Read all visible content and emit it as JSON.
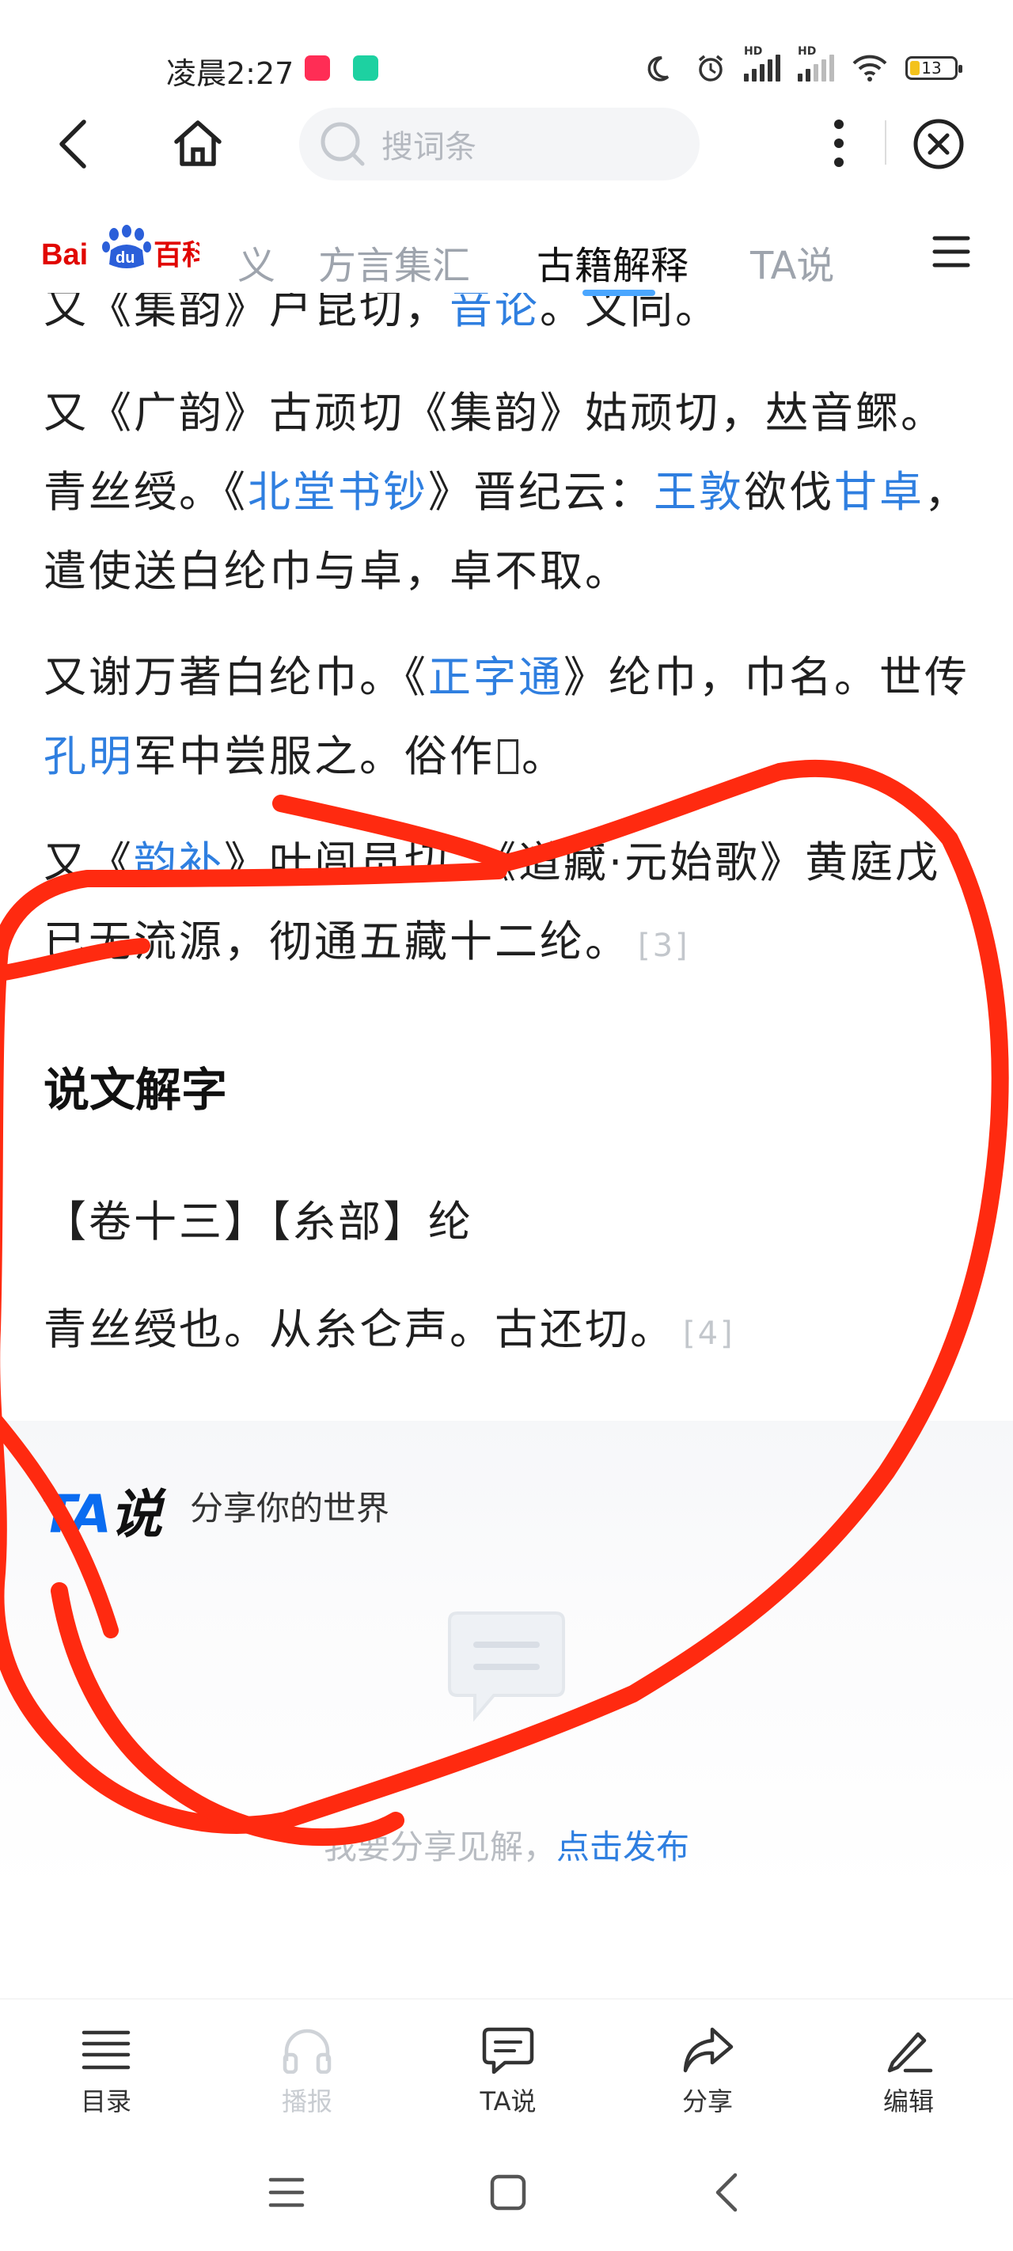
{
  "status_bar": {
    "time": "凌晨2:27",
    "badge1_color": "#ff2d55",
    "badge2_color": "#1dd1a1",
    "battery_level": "13",
    "network_labels": [
      "HD",
      "HD"
    ]
  },
  "nav": {
    "back_icon": "back-arrow-icon",
    "home_icon": "home-icon",
    "search_placeholder": "搜词条",
    "more_icon": "more-vertical-icon",
    "close_icon": "close-circle-icon"
  },
  "tabs": {
    "logo_text": "Bai du 百科",
    "items": [
      "义",
      "方言集汇",
      "古籍解释",
      "TA说"
    ],
    "active": "古籍解释",
    "menu_icon": "menu-icon"
  },
  "article": {
    "p0": {
      "a": "又《集韵》户昆切，",
      "link": "音论",
      "b": "。义同。"
    },
    "p1": {
      "a": "又《广韵》古顽切《集韵》姑顽切，𠀤音鳏。青丝绶。《",
      "link1": "北堂书钞",
      "b": "》晋纪云：",
      "link2": "王敦",
      "c": "欲伐",
      "link3": "甘卓",
      "d": "，遣使送白纶巾与卓，卓不取。"
    },
    "p2": {
      "a": "又谢万著白纶巾。《",
      "link1": "正字通",
      "b": "》纶巾，巾名。世传",
      "link2": "孔明",
      "c": "军中尝服之。俗作",
      "d": "。"
    },
    "p3": {
      "a": "又《",
      "link1": "韵补",
      "b": "》叶闾员切。《道藏·元始歌》黄庭戊已无流源，彻通五藏十二纶。",
      "cite": "[3]"
    },
    "shuowen_heading": "说文解字",
    "shuowen_volume": "【卷十三】【糸部】纶",
    "shuowen_text": "青丝绶也。从糸仑声。古还切。",
    "shuowen_cite": "[4]"
  },
  "ta_section": {
    "logo_ta": "TA",
    "logo_shuo": "说",
    "slogan": "分享你的世界",
    "publish_prefix": "我要分享见解，",
    "publish_link": "点击发布"
  },
  "toolbar": [
    {
      "label": "目录",
      "icon": "list-icon",
      "enabled": true
    },
    {
      "label": "播报",
      "icon": "headphones-icon",
      "enabled": false
    },
    {
      "label": "TA说",
      "icon": "comment-icon",
      "enabled": true
    },
    {
      "label": "分享",
      "icon": "share-icon",
      "enabled": true
    },
    {
      "label": "编辑",
      "icon": "edit-pen-icon",
      "enabled": true
    }
  ],
  "system_nav": [
    "menu-lines-icon",
    "square-home-icon",
    "back-chevron-icon"
  ],
  "colors": {
    "link": "#2f7fe0",
    "annotation_red": "#ff2a10",
    "tab_underline": "#4aa6ff",
    "ta_blue": "#0a6cf0"
  }
}
